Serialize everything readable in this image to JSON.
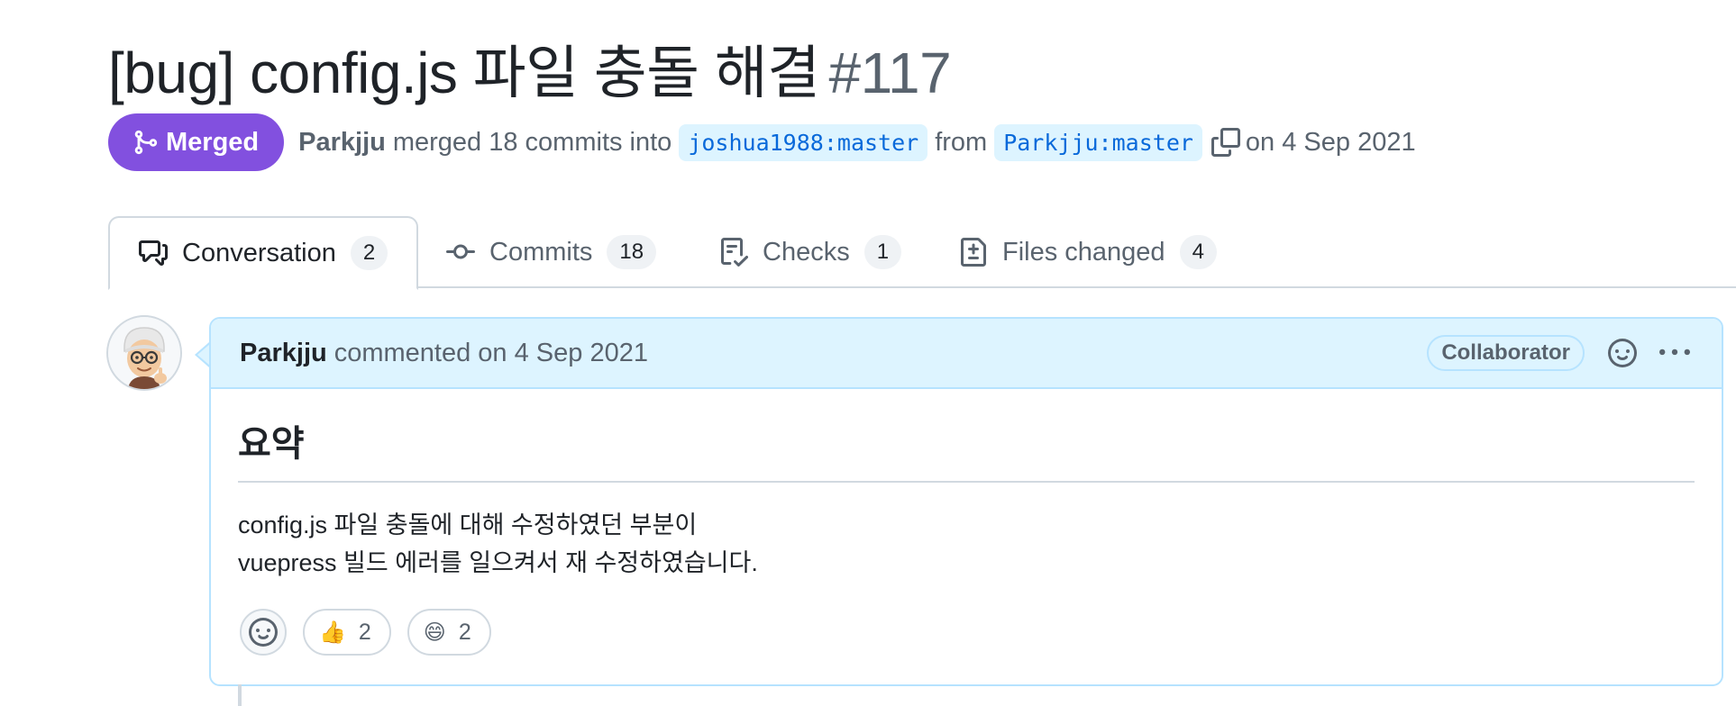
{
  "pr": {
    "title": "[bug] config.js 파일 충돌 해결",
    "number": "#117",
    "state": "Merged",
    "author": "Parkjju",
    "merged_text": "merged 18 commits into",
    "base_branch": "joshua1988:master",
    "from_text": "from",
    "head_branch": "Parkjju:master",
    "date_text": "on 4 Sep 2021"
  },
  "tabs": [
    {
      "label": "Conversation",
      "count": "2",
      "icon": "comment-discussion-icon"
    },
    {
      "label": "Commits",
      "count": "18",
      "icon": "git-commit-icon"
    },
    {
      "label": "Checks",
      "count": "1",
      "icon": "checklist-icon"
    },
    {
      "label": "Files changed",
      "count": "4",
      "icon": "file-diff-icon"
    }
  ],
  "comment": {
    "author": "Parkjju",
    "action_text": "commented on 4 Sep 2021",
    "role": "Collaborator",
    "heading": "요약",
    "lines": [
      "config.js 파일 충돌에 대해 수정하였던 부분이",
      "vuepress 빌드 에러를 일으켜서 재 수정하였습니다."
    ],
    "reactions": [
      {
        "emoji": "👍",
        "count": "2"
      },
      {
        "emoji": "😄",
        "count": "2"
      }
    ]
  },
  "colors": {
    "merged": "#8250df",
    "branch_bg": "#ddf4ff",
    "branch_text": "#0969da",
    "comment_header_bg": "#ddf4ff",
    "comment_border": "#b6e3ff"
  }
}
